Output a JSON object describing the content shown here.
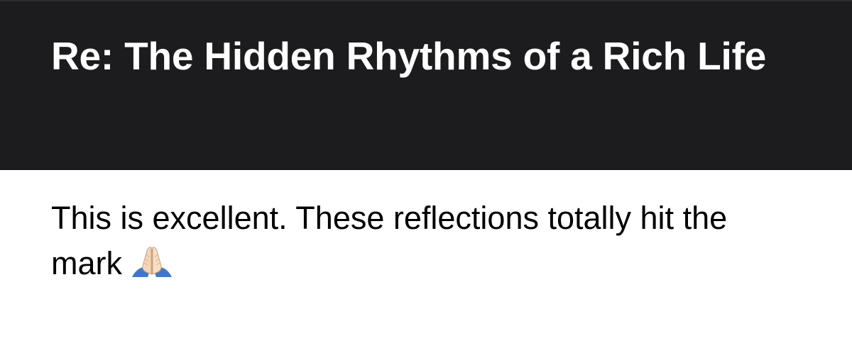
{
  "header": {
    "subject": "Re: The Hidden Rhythms of a Rich Life"
  },
  "message": {
    "text": "This is excellent. These reflections totally hit the mark",
    "emoji": "folded-hands-icon"
  }
}
